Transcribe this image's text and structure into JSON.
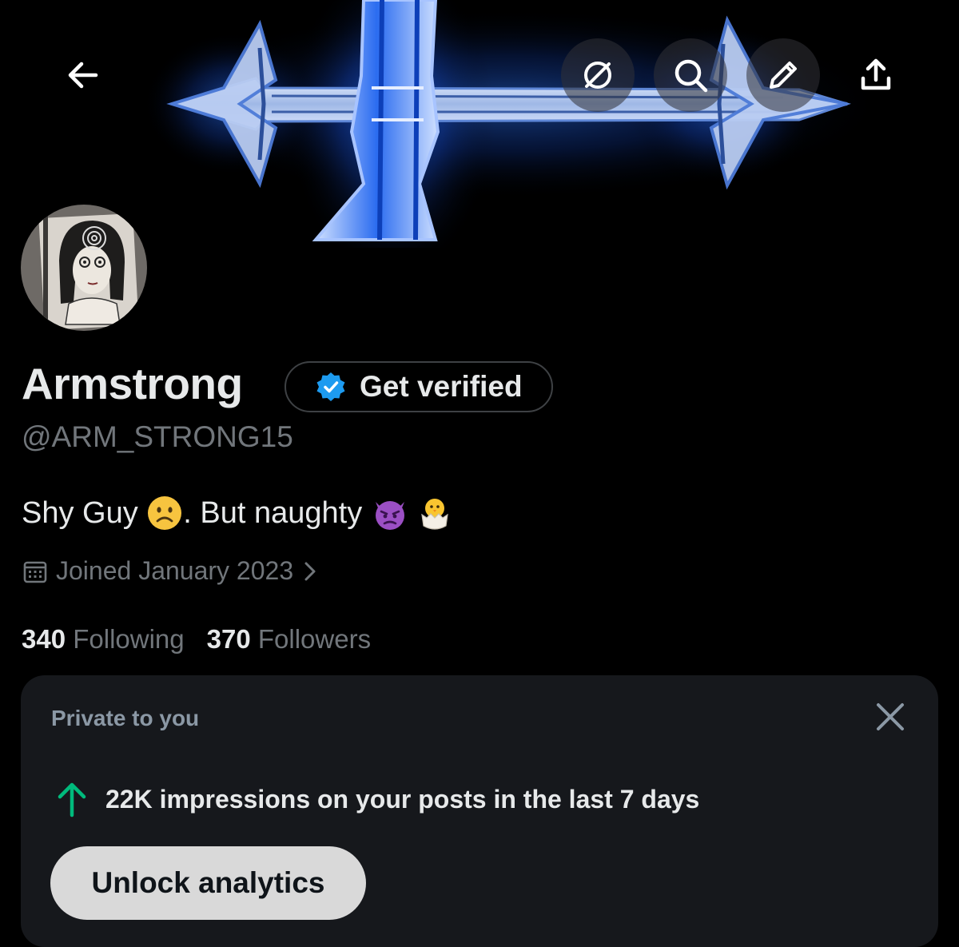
{
  "profile": {
    "name": "Armstrong",
    "handle": "@ARM_STRONG15",
    "bio_text_1": "Shy Guy ",
    "bio_text_2": ". But naughty ",
    "joined": "Joined January 2023",
    "verify_label": "Get verified"
  },
  "stats": {
    "following_count": "340",
    "following_label": "Following",
    "followers_count": "370",
    "followers_label": "Followers"
  },
  "card": {
    "private_label": "Private to you",
    "impressions_text": "22K impressions on your posts in the last 7 days",
    "unlock_label": "Unlock analytics"
  },
  "colors": {
    "accent": "#1d9bf0",
    "growth_arrow": "#00ba7c",
    "muted_text": "#71767b"
  },
  "icons": {
    "back": "back-arrow-icon",
    "grok": "grok-icon",
    "search": "search-icon",
    "edit": "pencil-icon",
    "share": "share-icon",
    "verified": "verified-badge-icon",
    "calendar": "calendar-icon",
    "close": "close-icon",
    "growth": "arrow-up-icon"
  }
}
